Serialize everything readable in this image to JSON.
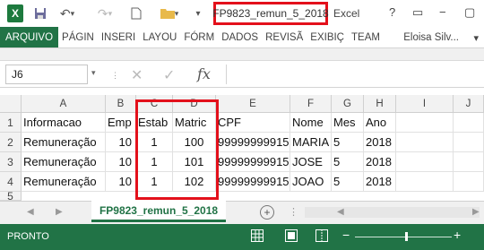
{
  "window": {
    "logo": "X",
    "title": "FP9823_remun_5_2018",
    "app": "Excel",
    "help": "?"
  },
  "ribbon": {
    "tabs": [
      "ARQUIVO",
      "PÁGIN",
      "INSERI",
      "LAYOU",
      "FÓRM",
      "DADOS",
      "REVISÃ",
      "EXIBIÇ",
      "TEAM"
    ],
    "user": "Eloisa Silv..."
  },
  "formula_bar": {
    "name_box": "J6",
    "fx": "fx",
    "content": ""
  },
  "sheet": {
    "columns": [
      "A",
      "B",
      "C",
      "D",
      "E",
      "F",
      "G",
      "H",
      "I",
      "J"
    ],
    "rows": [
      {
        "num": "1",
        "cells": [
          "Informacao",
          "Emp",
          "Estab",
          "Matric",
          "CPF",
          "Nome",
          "Mes",
          "Ano",
          "",
          ""
        ]
      },
      {
        "num": "2",
        "cells": [
          "Remuneração",
          "10",
          "1",
          "100",
          "99999999915",
          "MARIA",
          "5",
          "2018",
          "",
          ""
        ]
      },
      {
        "num": "3",
        "cells": [
          "Remuneração",
          "10",
          "1",
          "101",
          "99999999915",
          "JOSE",
          "5",
          "2018",
          "",
          ""
        ]
      },
      {
        "num": "4",
        "cells": [
          "Remuneração",
          "10",
          "1",
          "102",
          "99999999915",
          "JOAO",
          "5",
          "2018",
          "",
          ""
        ]
      },
      {
        "num": "5",
        "cells": [
          "",
          "",
          "",
          "",
          "",
          "",
          "",
          "",
          "",
          ""
        ]
      }
    ]
  },
  "sheet_tabs": {
    "active": "FP9823_remun_5_2018",
    "add_label": "+"
  },
  "status": {
    "ready": "PRONTO",
    "zoom_minus": "−",
    "zoom_plus": "+"
  },
  "colors": {
    "excel_green": "#217346",
    "highlight_red": "#e3101b"
  }
}
